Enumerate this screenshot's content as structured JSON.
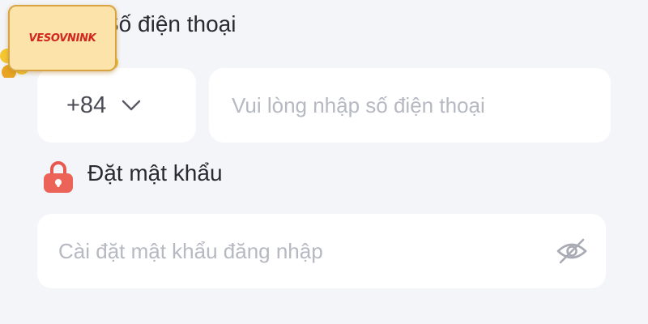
{
  "logo": {
    "text": "VESOVNINK"
  },
  "phone": {
    "label": "Số điện thoại",
    "country_code": "+84",
    "placeholder": "Vui lòng nhập số điện thoại",
    "value": ""
  },
  "password": {
    "label": "Đặt mật khẩu",
    "placeholder": "Cài đặt mật khẩu đăng nhập",
    "value": ""
  },
  "icons": {
    "country_dropdown": "chevron-down-icon",
    "password_label": "lock-icon",
    "password_toggle": "eye-slash-icon"
  },
  "colors": {
    "background": "#f4f5f9",
    "field_background": "#ffffff",
    "placeholder": "#b6b8c2",
    "label_text": "#2a2a33",
    "lock_icon": "#e85a4f",
    "logo_red": "#d2251d"
  }
}
